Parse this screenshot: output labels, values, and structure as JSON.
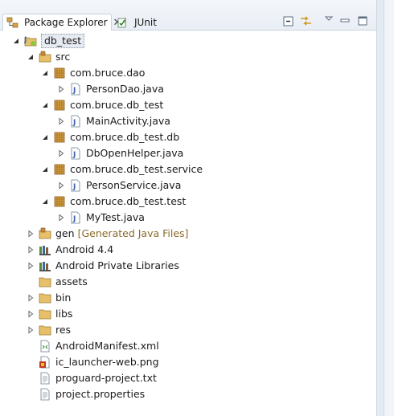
{
  "tabs": [
    {
      "label": "Package Explorer",
      "close": "✕",
      "icon": "package-explorer-icon"
    },
    {
      "label": "JUnit",
      "icon": "junit-icon"
    }
  ],
  "toolbar": {
    "collapse_all": "collapse-all-icon",
    "link_with_editor": "link-with-editor-icon",
    "view_menu": "view-menu-icon",
    "minimize": "minimize-icon",
    "maximize": "maximize-icon"
  },
  "tree": {
    "project": "db_test",
    "src": "src",
    "packages": [
      {
        "name": "com.bruce.dao",
        "file": "PersonDao.java"
      },
      {
        "name": "com.bruce.db_test",
        "file": "MainActivity.java"
      },
      {
        "name": "com.bruce.db_test.db",
        "file": "DbOpenHelper.java"
      },
      {
        "name": "com.bruce.db_test.service",
        "file": "PersonService.java"
      },
      {
        "name": "com.bruce.db_test.test",
        "file": "MyTest.java"
      }
    ],
    "gen": "gen",
    "gen_decoration": "[Generated Java Files]",
    "android_lib": "Android 4.4",
    "private_libs": "Android Private Libraries",
    "assets": "assets",
    "bin": "bin",
    "libs": "libs",
    "res": "res",
    "manifest": "AndroidManifest.xml",
    "launcher": "ic_launcher-web.png",
    "proguard": "proguard-project.txt",
    "properties": "project.properties"
  },
  "colors": {
    "folder": "#e8b84a",
    "package": "#c98a3a",
    "java_j": "#3a5fa8",
    "decoration": "#8a6b2a",
    "selection_bg": "#e6eaf1"
  }
}
